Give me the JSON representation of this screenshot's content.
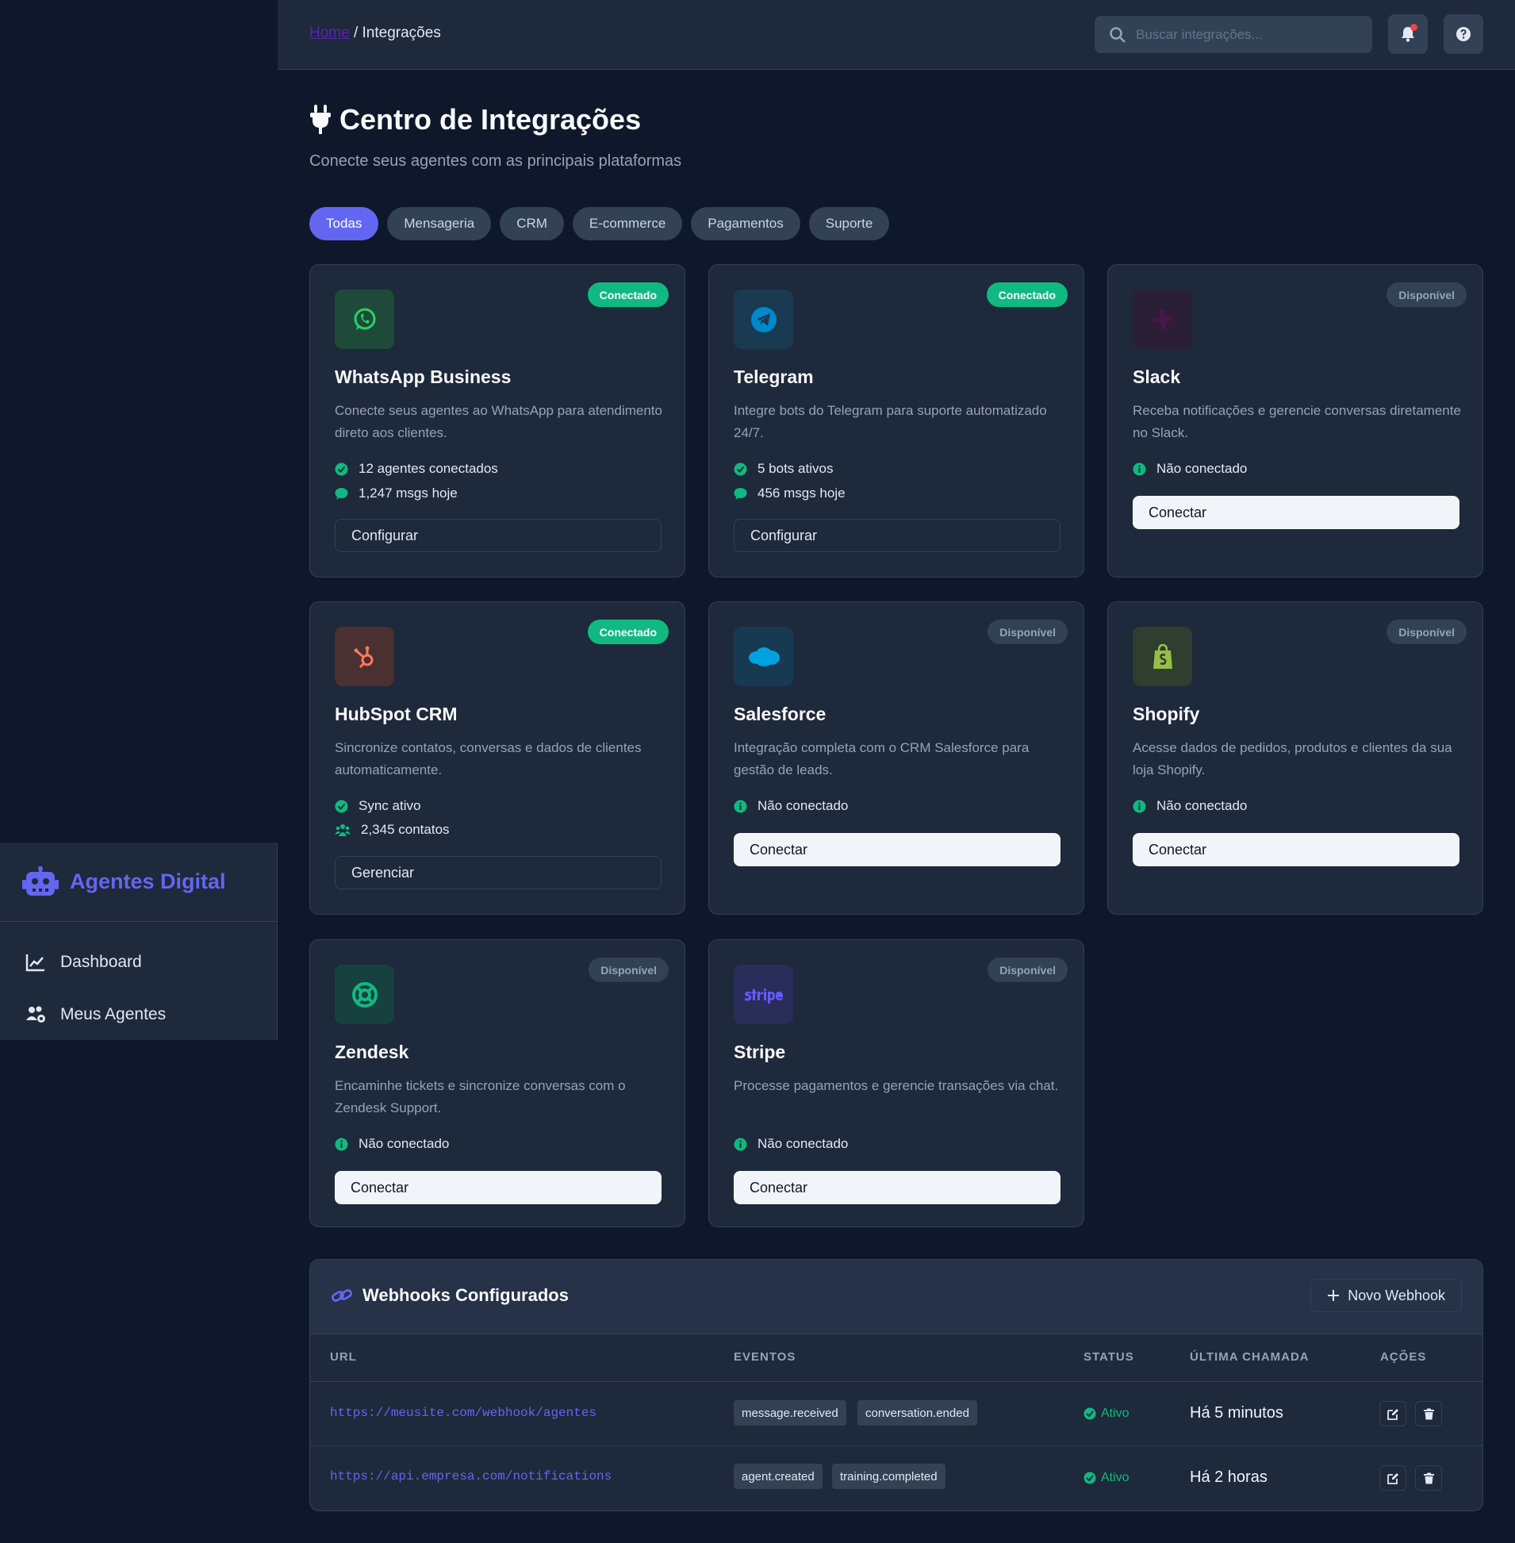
{
  "sidebar": {
    "brand": "Agentes Digital",
    "items": [
      {
        "label": "Dashboard",
        "icon": "chart-line-icon"
      },
      {
        "label": "Meus Agentes",
        "icon": "users-cog-icon"
      }
    ]
  },
  "header": {
    "breadcrumb_home": "Home",
    "breadcrumb_sep": "/",
    "breadcrumb_current": "Integrações",
    "search_placeholder": "Buscar integrações..."
  },
  "page": {
    "title": "Centro de Integrações",
    "subtitle": "Conecte seus agentes com as principais plataformas"
  },
  "tabs": [
    "Todas",
    "Mensageria",
    "CRM",
    "E-commerce",
    "Pagamentos",
    "Suporte"
  ],
  "integrations": [
    {
      "name": "WhatsApp Business",
      "badge": "Conectado",
      "desc": "Conecte seus agentes ao WhatsApp para atendimento direto aos clientes.",
      "stats": [
        "12 agentes conectados",
        "1,247 msgs hoje"
      ],
      "button": "Configurar",
      "icon": "whatsapp-icon",
      "color": "#25d366"
    },
    {
      "name": "Telegram",
      "badge": "Conectado",
      "desc": "Integre bots do Telegram para suporte automatizado 24/7.",
      "stats": [
        "5 bots ativos",
        "456 msgs hoje"
      ],
      "button": "Configurar",
      "icon": "telegram-icon",
      "color": "#0088cc"
    },
    {
      "name": "Slack",
      "badge": "Disponível",
      "desc": "Receba notificações e gerencie conversas diretamente no Slack.",
      "stats": [
        "Não conectado"
      ],
      "button": "Conectar",
      "icon": "slack-icon",
      "color": "#4a154b"
    },
    {
      "name": "HubSpot CRM",
      "badge": "Conectado",
      "desc": "Sincronize contatos, conversas e dados de clientes automaticamente.",
      "stats": [
        "Sync ativo",
        "2,345 contatos"
      ],
      "button": "Gerenciar",
      "icon": "hubspot-icon",
      "color": "#ff7a59"
    },
    {
      "name": "Salesforce",
      "badge": "Disponível",
      "desc": "Integração completa com o CRM Salesforce para gestão de leads.",
      "stats": [
        "Não conectado"
      ],
      "button": "Conectar",
      "icon": "salesforce-icon",
      "color": "#00a1e0"
    },
    {
      "name": "Shopify",
      "badge": "Disponível",
      "desc": "Acesse dados de pedidos, produtos e clientes da sua loja Shopify.",
      "stats": [
        "Não conectado"
      ],
      "button": "Conectar",
      "icon": "shopify-icon",
      "color": "#96bf48"
    },
    {
      "name": "Zendesk",
      "badge": "Disponível",
      "desc": "Encaminhe tickets e sincronize conversas com o Zendesk Support.",
      "stats": [
        "Não conectado"
      ],
      "button": "Conectar",
      "icon": "zendesk-icon",
      "color": "#03363d"
    },
    {
      "name": "Stripe",
      "badge": "Disponível",
      "desc": "Processe pagamentos e gerencie transações via chat.",
      "stats": [
        "Não conectado"
      ],
      "button": "Conectar",
      "icon": "stripe-icon",
      "color": "#635bff"
    }
  ],
  "webhooks": {
    "title": "Webhooks Configurados",
    "new_button": "Novo Webhook",
    "columns": [
      "URL",
      "EVENTOS",
      "STATUS",
      "ÚLTIMA CHAMADA",
      "AÇÕES"
    ],
    "rows": [
      {
        "url": "https://meusite.com/webhook/agentes",
        "events": [
          "message.received",
          "conversation.ended"
        ],
        "status": "Ativo",
        "last": "Há 5 minutos"
      },
      {
        "url": "https://api.empresa.com/notifications",
        "events": [
          "agent.created",
          "training.completed"
        ],
        "status": "Ativo",
        "last": "Há 2 horas"
      }
    ]
  },
  "colors": {
    "accent": "#6366f1",
    "success": "#10b981",
    "bg": "#0f172a",
    "surface": "#1e293b"
  }
}
